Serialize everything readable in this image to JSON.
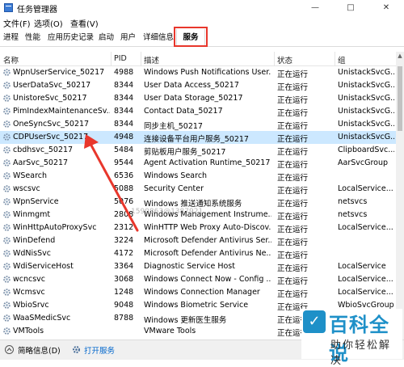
{
  "window": {
    "title": "任务管理器",
    "minimize": "—",
    "maximize": "□",
    "close": "✕"
  },
  "menu": [
    "文件(F)",
    "选项(O)",
    "查看(V)"
  ],
  "tabs": [
    "进程",
    "性能",
    "应用历史记录",
    "启动",
    "用户",
    "详细信息",
    "服务"
  ],
  "active_tab": "服务",
  "columns": {
    "name": "名称",
    "pid": "PID",
    "description": "描述",
    "status": "状态",
    "group": "组"
  },
  "rows": [
    {
      "name": "WpnUserService_50217",
      "pid": "4988",
      "description": "Windows Push Notifications User...",
      "status": "正在运行",
      "group": "UnistackSvcG..."
    },
    {
      "name": "UserDataSvc_50217",
      "pid": "8344",
      "description": "User Data Access_50217",
      "status": "正在运行",
      "group": "UnistackSvcG..."
    },
    {
      "name": "UnistoreSvc_50217",
      "pid": "8344",
      "description": "User Data Storage_50217",
      "status": "正在运行",
      "group": "UnistackSvcG..."
    },
    {
      "name": "PimIndexMaintenanceSv...",
      "pid": "8344",
      "description": "Contact Data_50217",
      "status": "正在运行",
      "group": "UnistackSvcG..."
    },
    {
      "name": "OneSyncSvc_50217",
      "pid": "8344",
      "description": "同步主机_50217",
      "status": "正在运行",
      "group": "UnistackSvcG..."
    },
    {
      "name": "CDPUserSvc_50217",
      "pid": "4948",
      "description": "连接设备平台用户服务_50217",
      "status": "正在运行",
      "group": "UnistackSvcG..."
    },
    {
      "name": "cbdhsvc_50217",
      "pid": "5484",
      "description": "剪贴板用户服务_50217",
      "status": "正在运行",
      "group": "ClipboardSvc..."
    },
    {
      "name": "AarSvc_50217",
      "pid": "9544",
      "description": "Agent Activation Runtime_50217",
      "status": "正在运行",
      "group": "AarSvcGroup"
    },
    {
      "name": "WSearch",
      "pid": "6536",
      "description": "Windows Search",
      "status": "正在运行",
      "group": ""
    },
    {
      "name": "wscsvc",
      "pid": "5088",
      "description": "Security Center",
      "status": "正在运行",
      "group": "LocalService..."
    },
    {
      "name": "WpnService",
      "pid": "5076",
      "description": "Windows 推送通知系统服务",
      "status": "正在运行",
      "group": "netsvcs"
    },
    {
      "name": "Winmgmt",
      "pid": "2808",
      "description": "Windows Management Instrume...",
      "status": "正在运行",
      "group": "netsvcs"
    },
    {
      "name": "WinHttpAutoProxySvc",
      "pid": "2312",
      "description": "WinHTTP Web Proxy Auto-Discov...",
      "status": "正在运行",
      "group": "LocalService..."
    },
    {
      "name": "WinDefend",
      "pid": "3224",
      "description": "Microsoft Defender Antivirus Ser...",
      "status": "正在运行",
      "group": ""
    },
    {
      "name": "WdNisSvc",
      "pid": "4172",
      "description": "Microsoft Defender Antivirus Ne...",
      "status": "正在运行",
      "group": ""
    },
    {
      "name": "WdiServiceHost",
      "pid": "3364",
      "description": "Diagnostic Service Host",
      "status": "正在运行",
      "group": "LocalService"
    },
    {
      "name": "wcncsvc",
      "pid": "3068",
      "description": "Windows Connect Now - Config ...",
      "status": "正在运行",
      "group": "LocalService..."
    },
    {
      "name": "Wcmsvc",
      "pid": "1248",
      "description": "Windows Connection Manager",
      "status": "正在运行",
      "group": "LocalService..."
    },
    {
      "name": "WbioSrvc",
      "pid": "9048",
      "description": "Windows Biometric Service",
      "status": "正在运行",
      "group": "WbioSvcGroup"
    },
    {
      "name": "WaaSMedicSvc",
      "pid": "8788",
      "description": "Windows 更新医生服务",
      "status": "正在运行",
      "group": "wusvcs"
    },
    {
      "name": "VMTools",
      "pid": "",
      "description": "VMware Tools",
      "status": "正在运行",
      "group": ""
    }
  ],
  "selected_row": 5,
  "footer": {
    "brief": "简略信息(D)",
    "open_services": "打开服务"
  },
  "watermark": "1590863@1387921",
  "brand": {
    "title": "百科全说",
    "subtitle": "助你轻松解决"
  },
  "colors": {
    "highlight": "#e8372c",
    "selection": "#cce8ff",
    "arrow": "#e8372c",
    "brand": "#1e90c8"
  }
}
